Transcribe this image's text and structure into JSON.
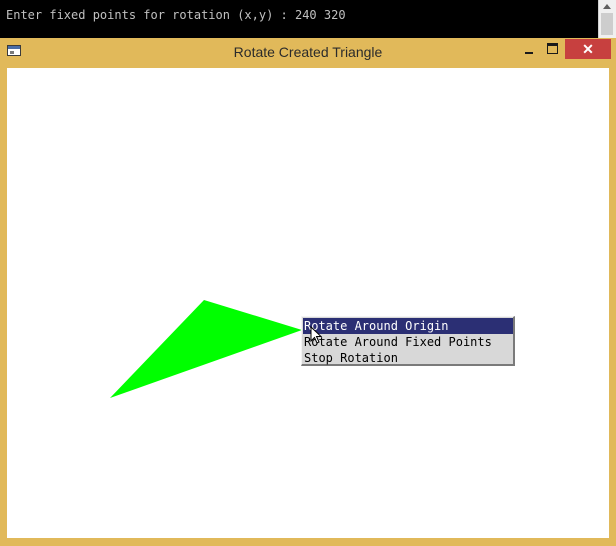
{
  "console": {
    "prompt_line": "Enter fixed points for rotation (x,y) : 240 320"
  },
  "window": {
    "title": "Rotate Created Triangle",
    "controls": {
      "minimize_icon": "minimize-icon",
      "maximize_icon": "maximize-icon",
      "close_icon": "close-icon",
      "close_glyph": "✕"
    }
  },
  "canvas": {
    "triangle_color": "#00ff00",
    "background_color": "#ffffff"
  },
  "context_menu": {
    "items": [
      {
        "label": "Rotate Around Origin",
        "highlighted": true
      },
      {
        "label": "Rotate Around Fixed Points",
        "highlighted": false
      },
      {
        "label": "Stop Rotation",
        "highlighted": false
      }
    ],
    "highlight_color": "#2b2f74"
  }
}
